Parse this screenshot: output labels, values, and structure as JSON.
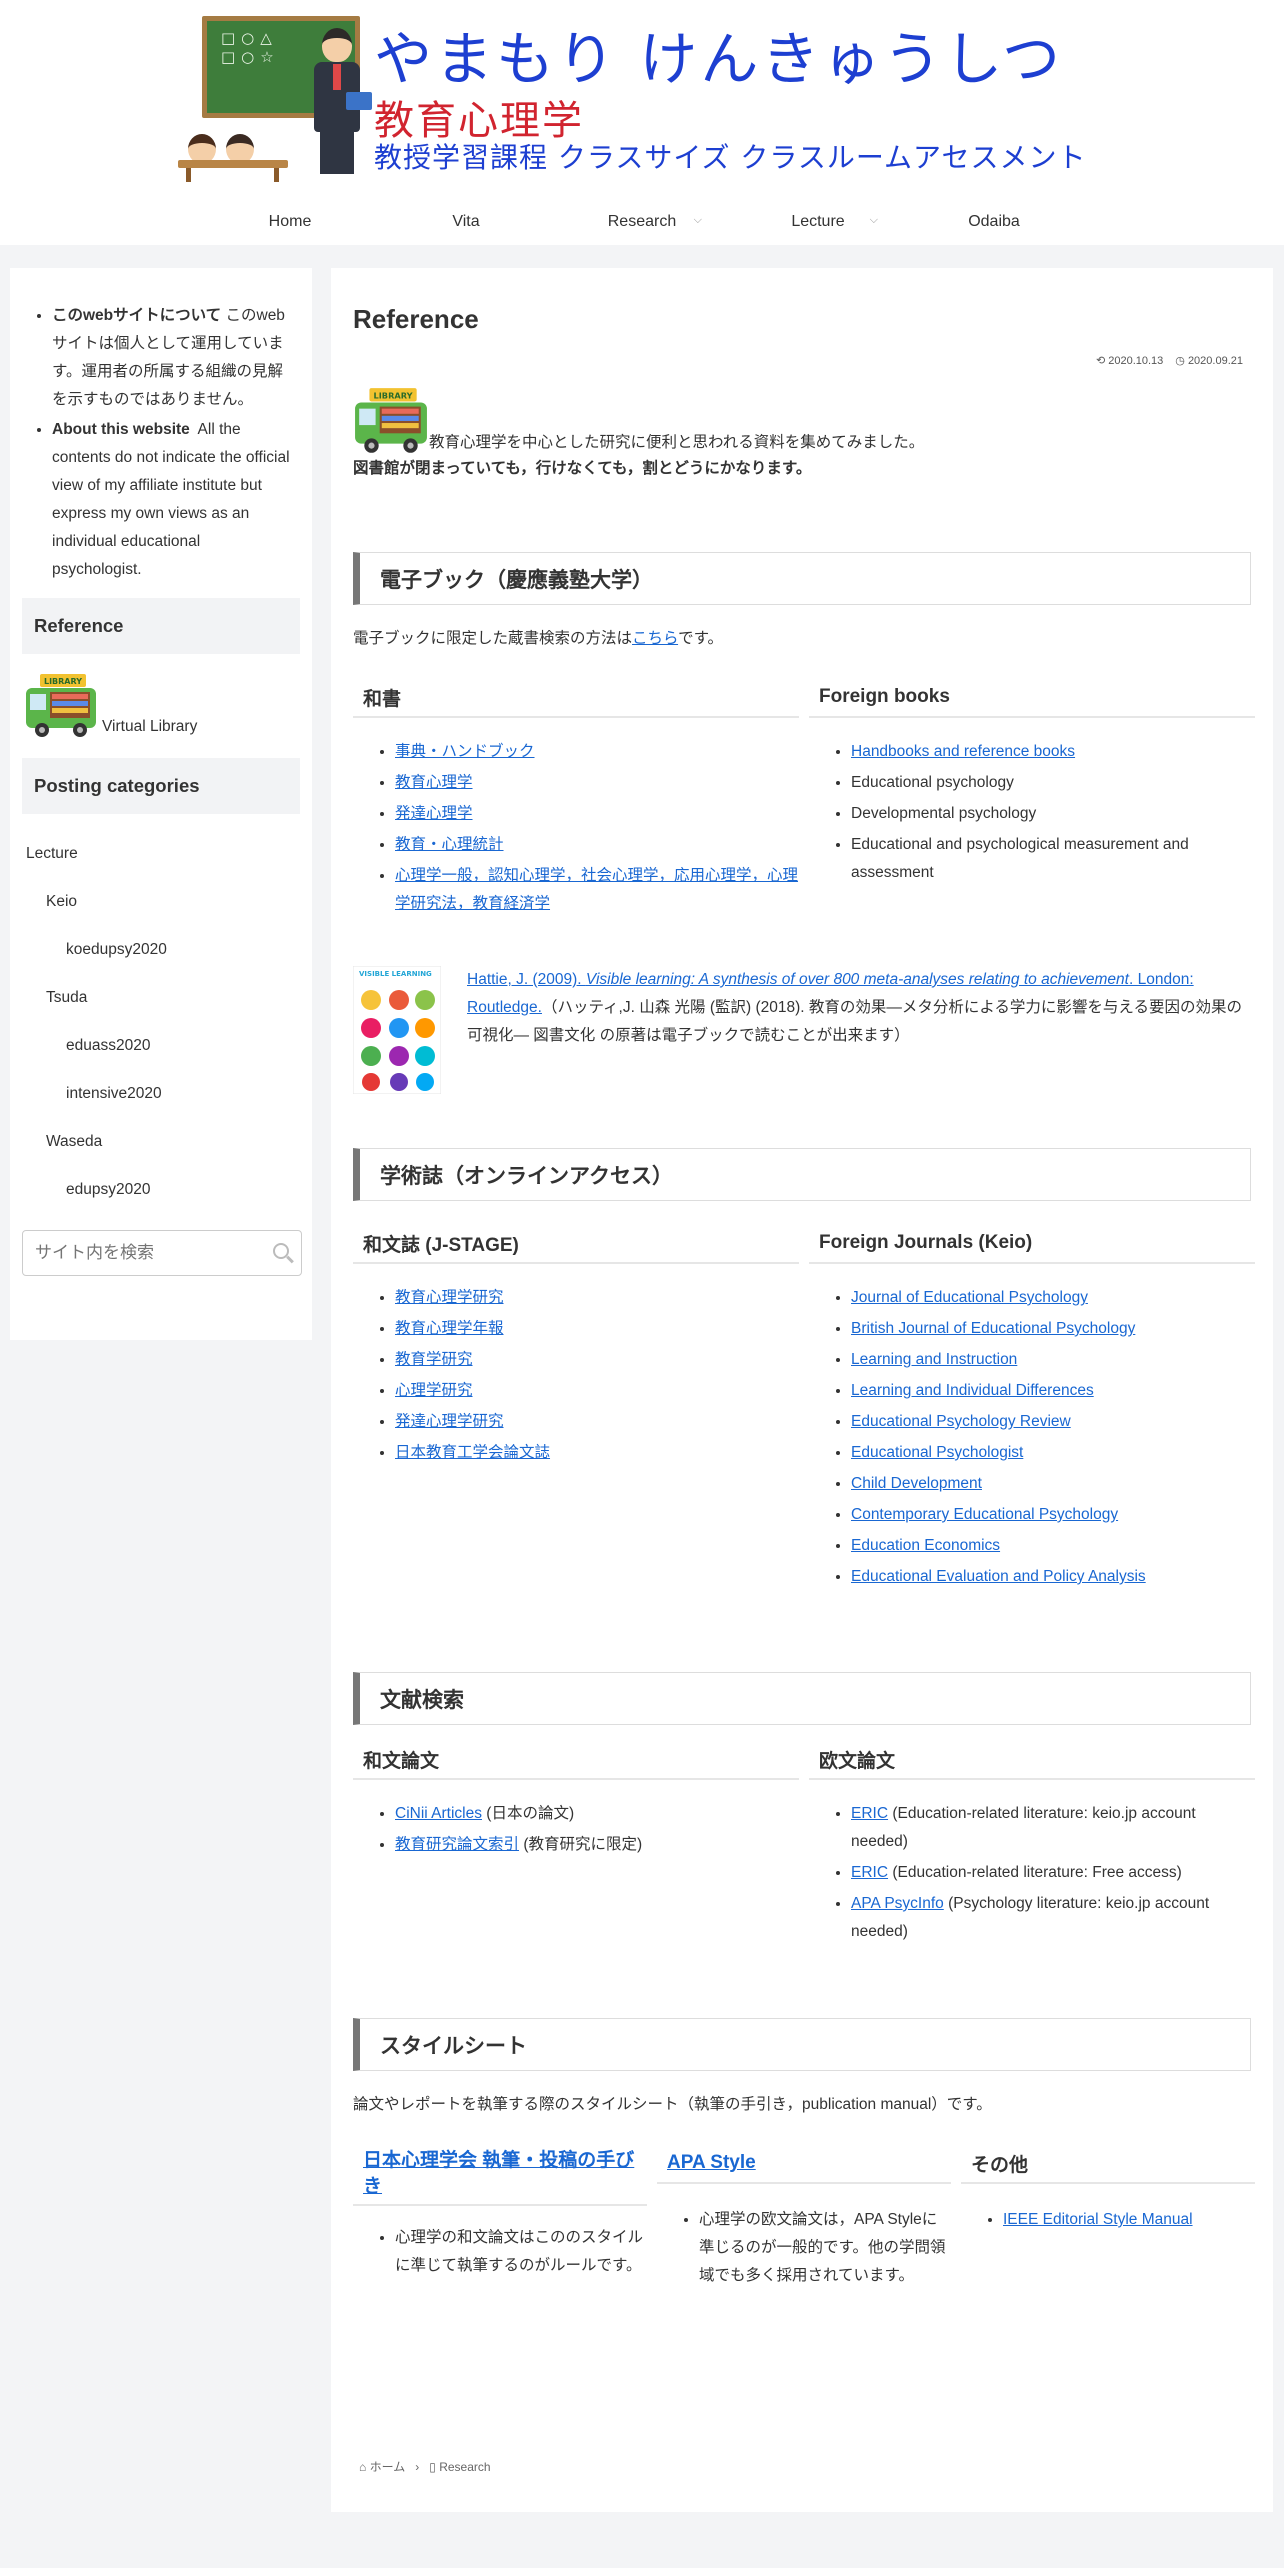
{
  "header": {
    "title_main": "やまもり けんきゅうしつ",
    "title_sub": "教育心理学",
    "tagline": "教授学習課程 クラスサイズ クラスルームアセスメント",
    "chalkboard_marks": "□○△\n□○☆"
  },
  "nav": [
    {
      "label": "Home"
    },
    {
      "label": "Vita"
    },
    {
      "label": "Research",
      "dropdown": true
    },
    {
      "label": "Lecture",
      "dropdown": true
    },
    {
      "label": "Odaiba"
    }
  ],
  "sidebar": {
    "about_jp_title": "このwebサイトについて",
    "about_jp_text": " このwebサイトは個人として運用しています。運用者の所属する組織の見解を示すものではありません。",
    "about_en_title": "About this website",
    "about_en_text": "  All the contents do not indicate the official view of my affiliate institute but express my own views as an individual educational psychologist.",
    "reference_heading": "Reference",
    "library_label": "Virtual Library",
    "library_sign": "LIBRARY",
    "categories_heading": "Posting categories",
    "categories": [
      {
        "label": "Lecture",
        "level": 1
      },
      {
        "label": "Keio",
        "level": 2
      },
      {
        "label": "koedupsy2020",
        "level": 3
      },
      {
        "label": "Tsuda",
        "level": 2
      },
      {
        "label": "eduass2020",
        "level": 3
      },
      {
        "label": "intensive2020",
        "level": 3
      },
      {
        "label": "Waseda",
        "level": 2
      },
      {
        "label": "edupsy2020",
        "level": 3
      }
    ],
    "search_placeholder": "サイト内を検索"
  },
  "main": {
    "title": "Reference",
    "date_updated": "2020.10.13",
    "date_published": "2020.09.21",
    "intro_line1": "教育心理学を中心とした研究に便利と思われる資料を集めてみました。",
    "intro_line2": "図書館が閉まっていても，行けなくても，割とどうにかなります。",
    "ebook": {
      "heading": "電子ブック（慶應義塾大学）",
      "note_prefix": "電子ブックに限定した蔵書検索の方法は",
      "note_link": "こちら",
      "note_suffix": "です。",
      "jp_heading": "和書",
      "jp_items": [
        "事典・ハンドブック",
        "教育心理学",
        "発達心理学",
        "教育・心理統計",
        "心理学一般，認知心理学，社会心理学，応用心理学，心理学研究法，教育経済学"
      ],
      "en_heading": "Foreign books",
      "en_items": [
        {
          "label": "Handbooks and reference books",
          "link": true
        },
        {
          "label": "Educational psychology",
          "link": false
        },
        {
          "label": "Developmental psychology",
          "link": false
        },
        {
          "label": "Educational and psychological measurement and assessment",
          "link": false
        }
      ],
      "hattie_cover_title": "VISIBLE LEARNING",
      "hattie_link_a": "Hattie, J. (2009). ",
      "hattie_link_b": "Visible learning: A synthesis of over 800 meta-analyses relating to achievement",
      "hattie_link_c": ". London: Routledge.",
      "hattie_text": "（ハッティ,J. 山森 光陽 (監訳) (2018). 教育の効果―メタ分析による学力に影響を与える要因の効果の可視化― 図書文化 の原著は電子ブックで読むことが出来ます）"
    },
    "journals": {
      "heading": "学術誌（オンラインアクセス）",
      "jp_heading": "和文誌 (J-STAGE)",
      "jp_items": [
        "教育心理学研究",
        "教育心理学年報",
        "教育学研究",
        "心理学研究",
        "発達心理学研究",
        "日本教育工学会論文誌"
      ],
      "en_heading": "Foreign Journals (Keio)",
      "en_items": [
        "Journal of Educational Psychology",
        "British Journal of Educational Psychology",
        "Learning and Instruction",
        "Learning and Individual Differences",
        "Educational Psychology Review",
        "Educational Psychologist",
        "Child Development",
        "Contemporary Educational Psychology",
        "Education Economics",
        "Educational Evaluation and Policy Analysis"
      ]
    },
    "literature": {
      "heading": "文献検索",
      "jp_heading": "和文論文",
      "jp_items": [
        {
          "link": "CiNii Articles",
          "text": " (日本の論文)"
        },
        {
          "link": "教育研究論文索引",
          "text": " (教育研究に限定)"
        }
      ],
      "en_heading": "欧文論文",
      "en_items": [
        {
          "link": "ERIC",
          "text": " (Education-related literature: keio.jp account needed)"
        },
        {
          "link": "ERIC",
          "text": " (Education-related literature: Free access)"
        },
        {
          "link": "APA PsycInfo",
          "text": " (Psychology literature: keio.jp account needed)"
        }
      ]
    },
    "styles": {
      "heading": "スタイルシート",
      "note": "論文やレポートを執筆する際のスタイルシート（執筆の手引き，publication manual）です。",
      "col1_heading": "日本心理学会 執筆・投稿の手びき",
      "col1_text": "心理学の和文論文はこののスタイルに準じて執筆するのがルールです。",
      "col2_heading": "APA Style",
      "col2_text": "心理学の欧文論文は，APA Styleに準じるのが一般的です。他の学問領域でも多く採用されています。",
      "col3_heading": "その他",
      "col3_link": "IEEE Editorial Style Manual"
    },
    "breadcrumb": {
      "home": "ホーム",
      "current": "Research"
    }
  }
}
